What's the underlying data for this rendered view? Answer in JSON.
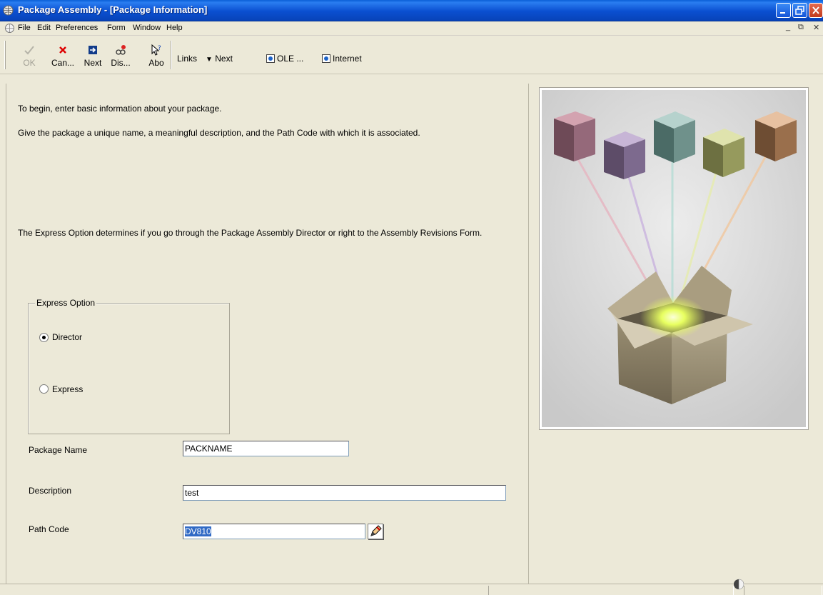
{
  "window": {
    "title": "Package Assembly - [Package Information]"
  },
  "menu": {
    "items": [
      "File",
      "Edit",
      "Preferences",
      "Form",
      "Window",
      "Help"
    ]
  },
  "toolbar": {
    "ok": "OK",
    "cancel": "Can...",
    "next": "Next",
    "display": "Dis...",
    "about": "Abo",
    "links": "Links",
    "links_next": "Next",
    "ole": "OLE ...",
    "internet": "Internet"
  },
  "form": {
    "intro_line1": "To begin, enter basic information about your package.",
    "intro_line2": "Give the package a unique name, a meaningful description, and the Path Code with which it is associated.",
    "express_note": "The Express Option determines if you go through the Package Assembly Director or right to the Assembly Revisions Form.",
    "express_option": {
      "legend": "Express Option",
      "director_label": "Director",
      "express_label": "Express",
      "selected": "Director"
    },
    "package_name": {
      "label": "Package Name",
      "value": "PACKNAME"
    },
    "description": {
      "label": "Description",
      "value": "test"
    },
    "path_code": {
      "label": "Path Code",
      "value": "DV810"
    }
  },
  "colors": {
    "titlebar": "#0a4fd0",
    "background": "#ece9d8",
    "selection": "#316ac5",
    "cube_colors": [
      "#b07384",
      "#8f7f9e",
      "#6f958f",
      "#9ea66c",
      "#a67a54"
    ]
  }
}
